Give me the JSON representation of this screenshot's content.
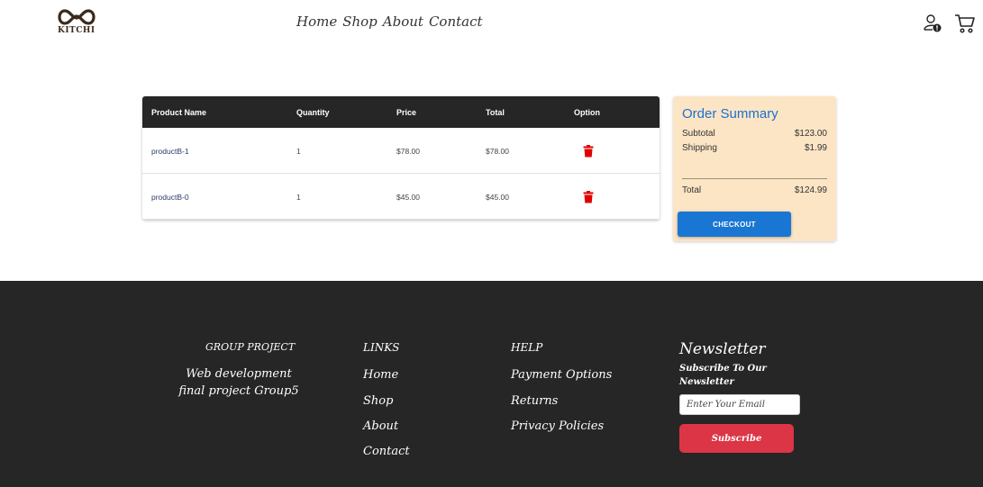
{
  "header": {
    "logo_text": "KITCHI",
    "nav": [
      "Home",
      "Shop",
      "About",
      "Contact"
    ],
    "user_icon": "user-alert-icon",
    "cart_icon": "cart-icon"
  },
  "cart": {
    "columns": [
      "Product Name",
      "Quantity",
      "Price",
      "Total",
      "Option"
    ],
    "rows": [
      {
        "name": "productB-1",
        "quantity": "1",
        "price": "$78.00",
        "total": "$78.00",
        "option_icon": "trash-icon"
      },
      {
        "name": "productB-0",
        "quantity": "1",
        "price": "$45.00",
        "total": "$45.00",
        "option_icon": "trash-icon"
      }
    ]
  },
  "summary": {
    "title": "Order Summary",
    "subtotal_label": "Subtotal",
    "subtotal_value": "$123.00",
    "shipping_label": "Shipping",
    "shipping_value": "$1.99",
    "total_label": "Total",
    "total_value": "$124.99",
    "checkout_label": "CHECKOUT"
  },
  "footer": {
    "group": {
      "heading": "GROUP PROJECT",
      "line1": "Web development",
      "line2": "final project Group5"
    },
    "links": {
      "heading": "LINKS",
      "items": [
        "Home",
        "Shop",
        "About",
        "Contact"
      ]
    },
    "help": {
      "heading": "HELP",
      "items": [
        "Payment Options",
        "Returns",
        "Privacy Policies"
      ]
    },
    "newsletter": {
      "title": "Newsletter",
      "subtitle": "Subscribe To Our Newsletter",
      "placeholder": "Enter Your Email",
      "button": "Subscribe"
    }
  },
  "colors": {
    "accent_blue": "#1976d2",
    "summary_bg": "#fce5c5",
    "dark": "#262626",
    "danger": "#dc3545",
    "trash_red": "#e00000"
  }
}
